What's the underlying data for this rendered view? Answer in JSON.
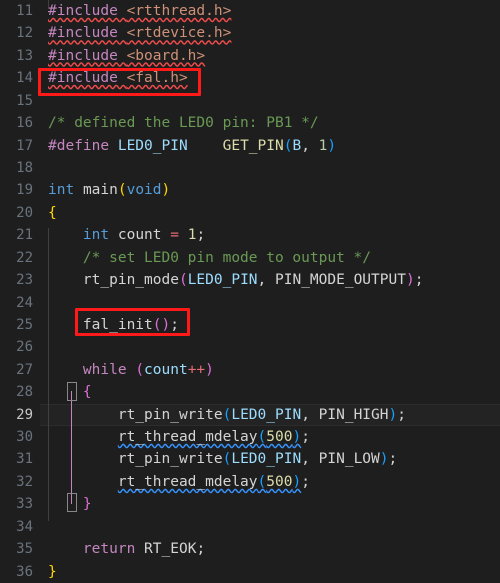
{
  "editor": {
    "name": "code-editor",
    "language": "c",
    "theme": "dark-plus",
    "background": "#1e1e1e",
    "active_line": 29,
    "first_line": 11,
    "last_line": 36,
    "gutter_color": "#6a737d",
    "gutter_active_color": "#c6c6c6",
    "annotation_color": "#ff1a1a",
    "error_squiggle_color": "#f14c4c",
    "warning_squiggle_color": "#3794ff"
  },
  "lines": [
    {
      "number": "11",
      "text": "#include <rtthread.h>"
    },
    {
      "number": "12",
      "text": "#include <rtdevice.h>"
    },
    {
      "number": "13",
      "text": "#include <board.h>"
    },
    {
      "number": "14",
      "text": "#include <fal.h>"
    },
    {
      "number": "15",
      "text": ""
    },
    {
      "number": "16",
      "text": "/* defined the LED0 pin: PB1 */"
    },
    {
      "number": "17",
      "text": "#define LED0_PIN     GET_PIN(B, 1)"
    },
    {
      "number": "18",
      "text": ""
    },
    {
      "number": "19",
      "text": "int main(void)"
    },
    {
      "number": "20",
      "text": "{"
    },
    {
      "number": "21",
      "text": "    int count = 1;"
    },
    {
      "number": "22",
      "text": "    /* set LED0 pin mode to output */"
    },
    {
      "number": "23",
      "text": "    rt_pin_mode(LED0_PIN, PIN_MODE_OUTPUT);"
    },
    {
      "number": "24",
      "text": ""
    },
    {
      "number": "25",
      "text": "    fal_init();"
    },
    {
      "number": "26",
      "text": ""
    },
    {
      "number": "27",
      "text": "    while (count++)"
    },
    {
      "number": "28",
      "text": "    {"
    },
    {
      "number": "29",
      "text": "        rt_pin_write(LED0_PIN, PIN_HIGH);"
    },
    {
      "number": "30",
      "text": "        rt_thread_mdelay(500);"
    },
    {
      "number": "31",
      "text": "        rt_pin_write(LED0_PIN, PIN_LOW);"
    },
    {
      "number": "32",
      "text": "        rt_thread_mdelay(500);"
    },
    {
      "number": "33",
      "text": "    }"
    },
    {
      "number": "34",
      "text": ""
    },
    {
      "number": "35",
      "text": "    return RT_EOK;"
    },
    {
      "number": "36",
      "text": "}"
    }
  ],
  "tokens": {
    "l11": {
      "directive": "#include",
      "header": "<rtthread.h>"
    },
    "l12": {
      "directive": "#include",
      "header": "<rtdevice.h>"
    },
    "l13": {
      "directive": "#include",
      "header": "<board.h>"
    },
    "l14": {
      "directive": "#include",
      "header": "<fal.h>"
    },
    "l16": {
      "comment": "/* defined the LED0 pin: PB1 */"
    },
    "l17": {
      "directive": "#define",
      "macro": "LED0_PIN",
      "gap": "    ",
      "fn": "GET_PIN",
      "open": "(",
      "arg1": "B",
      "comma": ", ",
      "arg2": "1",
      "close": ")"
    },
    "l19": {
      "type": "int",
      "space": " ",
      "fn": "main",
      "open": "(",
      "arg": "void",
      "close": ")"
    },
    "l20": {
      "brace": "{"
    },
    "l21": {
      "type": "int",
      "name": " count ",
      "eq": "=",
      "num": " 1",
      "semi": ";"
    },
    "l22": {
      "comment": "/* set LED0 pin mode to output */"
    },
    "l23": {
      "fn": "rt_pin_mode",
      "open": "(",
      "arg1": "LED0_PIN",
      "comma": ", ",
      "arg2": "PIN_MODE_OUTPUT",
      "close": ")",
      "semi": ";"
    },
    "l25": {
      "fn": "fal_init",
      "open": "(",
      "close": ")",
      "semi": ";"
    },
    "l27": {
      "kw": "while",
      "space": " ",
      "open": "(",
      "name": "count",
      "op": "++",
      "close": ")"
    },
    "l28": {
      "brace": "{"
    },
    "l29": {
      "fn": "rt_pin_write",
      "open": "(",
      "arg1": "LED0_PIN",
      "comma": ", ",
      "arg2": "PIN_HIGH",
      "close": ")",
      "semi": ";"
    },
    "l30": {
      "fn": "rt_thread_mdelay",
      "open": "(",
      "num": "500",
      "close": ")",
      "semi": ";"
    },
    "l31": {
      "fn": "rt_pin_write",
      "open": "(",
      "arg1": "LED0_PIN",
      "comma": ", ",
      "arg2": "PIN_LOW",
      "close": ")",
      "semi": ";"
    },
    "l32": {
      "fn": "rt_thread_mdelay",
      "open": "(",
      "num": "500",
      "close": ")",
      "semi": ";"
    },
    "l33": {
      "brace": "}"
    },
    "l35": {
      "kw": "return",
      "space": " ",
      "name": "RT_EOK",
      "semi": ";"
    },
    "l36": {
      "brace": "}"
    }
  },
  "annotations": [
    {
      "name": "highlight-include-fal",
      "target_line": "14",
      "label": "#include <fal.h>"
    },
    {
      "name": "highlight-fal-init",
      "target_line": "25",
      "label": "fal_init();"
    }
  ]
}
